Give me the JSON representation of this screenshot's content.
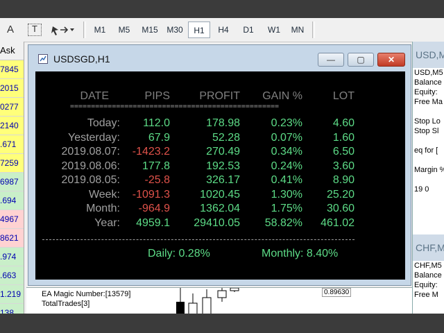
{
  "toolbar": {
    "tools": [
      {
        "label": "A",
        "icon": "text-tool-icon"
      },
      {
        "label": "T",
        "icon": "text-label-icon"
      },
      {
        "label": "",
        "icon": "arrow-shapes-icon"
      }
    ],
    "timeframes": [
      "M1",
      "M5",
      "M15",
      "M30",
      "H1",
      "H4",
      "D1",
      "W1",
      "MN"
    ],
    "active_timeframe": "H1"
  },
  "market_watch": {
    "header": "Ask",
    "cells": [
      {
        "value": "7845",
        "tone": "y"
      },
      {
        "value": "2015",
        "tone": "y"
      },
      {
        "value": "0277",
        "tone": "y"
      },
      {
        "value": "2140",
        "tone": "y"
      },
      {
        "value": ".671",
        "tone": "y"
      },
      {
        "value": "7259",
        "tone": "y"
      },
      {
        "value": "6987",
        "tone": "g"
      },
      {
        "value": ".694",
        "tone": "g"
      },
      {
        "value": "4967",
        "tone": "r"
      },
      {
        "value": "8621",
        "tone": "r"
      },
      {
        "value": ".974",
        "tone": "g"
      },
      {
        "value": ".663",
        "tone": "g"
      },
      {
        "value": "1.219",
        "tone": "g"
      },
      {
        "value": "138",
        "tone": "g"
      }
    ]
  },
  "window": {
    "title": "USDSGD,H1",
    "minimize": "—",
    "maximize": "▢",
    "close": "✕"
  },
  "stats": {
    "headers": [
      "DATE",
      "PIPS",
      "PROFIT",
      "GAIN %",
      "LOT"
    ],
    "separator": "==================================================",
    "rows": [
      {
        "label": "Today:",
        "pips": "112.0",
        "profit": "178.98",
        "gain": "0.23%",
        "lot": "4.60",
        "pips_negative": false
      },
      {
        "label": "Yesterday:",
        "pips": "67.9",
        "profit": "52.28",
        "gain": "0.07%",
        "lot": "1.60",
        "pips_negative": false
      },
      {
        "label": "2019.08.07:",
        "pips": "-1423.2",
        "profit": "270.49",
        "gain": "0.34%",
        "lot": "6.50",
        "pips_negative": true
      },
      {
        "label": "2019.08.06:",
        "pips": "177.8",
        "profit": "192.53",
        "gain": "0.24%",
        "lot": "3.60",
        "pips_negative": false
      },
      {
        "label": "2019.08.05:",
        "pips": "-25.8",
        "profit": "326.17",
        "gain": "0.41%",
        "lot": "8.90",
        "pips_negative": true
      },
      {
        "label": "Week:",
        "pips": "-1091.3",
        "profit": "1020.45",
        "gain": "1.30%",
        "lot": "25.20",
        "pips_negative": true
      },
      {
        "label": "Month:",
        "pips": "-964.9",
        "profit": "1362.04",
        "gain": "1.75%",
        "lot": "30.60",
        "pips_negative": true
      },
      {
        "label": "Year:",
        "pips": "4959.1",
        "profit": "29410.05",
        "gain": "58.82%",
        "lot": "461.02",
        "pips_negative": false
      }
    ],
    "daily": "Daily: 0.28%",
    "monthly": "Monthly: 8.40%",
    "colors": {
      "positive": "#5ddc87",
      "negative": "#e0524a",
      "label": "#a0a0a0",
      "header": "#808080"
    }
  },
  "bg_chart": {
    "lines": [
      "EA Magic Number:[13579]",
      "TotalTrades[3]"
    ],
    "price": "0.89630"
  },
  "right_windows": [
    {
      "title": "USD,M",
      "lines": [
        "USD,M5",
        "Balance",
        "Equity:",
        "Free Ma",
        "",
        "Stop Lo",
        "Stop Sl",
        "",
        "eq for [",
        "",
        "Margin %",
        "",
        "19    0"
      ]
    },
    {
      "title": "CHF,M",
      "lines": [
        "CHF,M5",
        "Balance",
        "Equity:",
        "Free M"
      ]
    }
  ]
}
